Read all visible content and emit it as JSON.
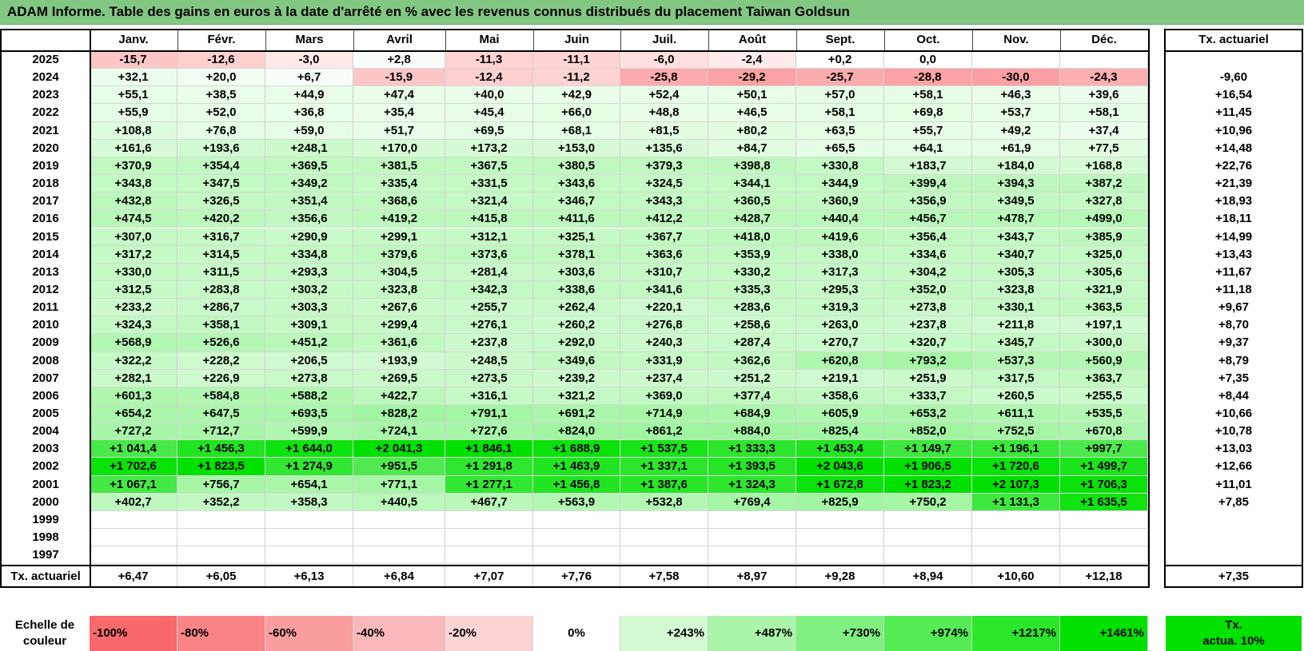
{
  "title": "ADAM Informe. Table des gains en euros à la date d'arrêté en % avec les revenus connus distribués du placement Taiwan Goldsun",
  "months": [
    "Janv.",
    "Févr.",
    "Mars",
    "Avril",
    "Mai",
    "Juin",
    "Juil.",
    "Août",
    "Sept.",
    "Oct.",
    "Nov.",
    "Déc."
  ],
  "rate_header": "Tx. actuariel",
  "rows": [
    {
      "year": "2025",
      "values": [
        "-15,7",
        "-12,6",
        "-3,0",
        "+2,8",
        "-11,3",
        "-11,1",
        "-6,0",
        "-2,4",
        "+0,2",
        "0,0",
        "",
        ""
      ],
      "rate": ""
    },
    {
      "year": "2024",
      "values": [
        "+32,1",
        "+20,0",
        "+6,7",
        "-15,9",
        "-12,4",
        "-11,2",
        "-25,8",
        "-29,2",
        "-25,7",
        "-28,8",
        "-30,0",
        "-24,3"
      ],
      "rate": "-9,60"
    },
    {
      "year": "2023",
      "values": [
        "+55,1",
        "+38,5",
        "+44,9",
        "+47,4",
        "+40,0",
        "+42,9",
        "+52,4",
        "+50,1",
        "+57,0",
        "+58,1",
        "+46,3",
        "+39,6"
      ],
      "rate": "+16,54"
    },
    {
      "year": "2022",
      "values": [
        "+55,9",
        "+52,0",
        "+36,8",
        "+35,4",
        "+45,4",
        "+66,0",
        "+48,8",
        "+46,5",
        "+58,1",
        "+69,8",
        "+53,7",
        "+58,1"
      ],
      "rate": "+11,45"
    },
    {
      "year": "2021",
      "values": [
        "+108,8",
        "+76,8",
        "+59,0",
        "+51,7",
        "+69,5",
        "+68,1",
        "+81,5",
        "+80,2",
        "+63,5",
        "+55,7",
        "+49,2",
        "+37,4"
      ],
      "rate": "+10,96"
    },
    {
      "year": "2020",
      "values": [
        "+161,6",
        "+193,6",
        "+248,1",
        "+170,0",
        "+173,2",
        "+153,0",
        "+135,6",
        "+84,7",
        "+65,5",
        "+64,1",
        "+61,9",
        "+77,5"
      ],
      "rate": "+14,48"
    },
    {
      "year": "2019",
      "values": [
        "+370,9",
        "+354,4",
        "+369,5",
        "+381,5",
        "+367,5",
        "+380,5",
        "+379,3",
        "+398,8",
        "+330,8",
        "+183,7",
        "+184,0",
        "+168,8"
      ],
      "rate": "+22,76"
    },
    {
      "year": "2018",
      "values": [
        "+343,8",
        "+347,5",
        "+349,2",
        "+335,4",
        "+331,5",
        "+343,6",
        "+324,5",
        "+344,1",
        "+344,9",
        "+399,4",
        "+394,3",
        "+387,2"
      ],
      "rate": "+21,39"
    },
    {
      "year": "2017",
      "values": [
        "+432,8",
        "+326,5",
        "+351,4",
        "+368,6",
        "+321,4",
        "+346,7",
        "+343,3",
        "+360,5",
        "+360,9",
        "+356,9",
        "+349,5",
        "+327,8"
      ],
      "rate": "+18,93"
    },
    {
      "year": "2016",
      "values": [
        "+474,5",
        "+420,2",
        "+356,6",
        "+419,2",
        "+415,8",
        "+411,6",
        "+412,2",
        "+428,7",
        "+440,4",
        "+456,7",
        "+478,7",
        "+499,0"
      ],
      "rate": "+18,11"
    },
    {
      "year": "2015",
      "values": [
        "+307,0",
        "+316,7",
        "+290,9",
        "+299,1",
        "+312,1",
        "+325,1",
        "+367,7",
        "+418,0",
        "+419,6",
        "+356,4",
        "+343,7",
        "+385,9"
      ],
      "rate": "+14,99"
    },
    {
      "year": "2014",
      "values": [
        "+317,2",
        "+314,5",
        "+334,8",
        "+379,6",
        "+373,6",
        "+378,1",
        "+363,6",
        "+353,9",
        "+338,0",
        "+334,6",
        "+340,7",
        "+325,0"
      ],
      "rate": "+13,43"
    },
    {
      "year": "2013",
      "values": [
        "+330,0",
        "+311,5",
        "+293,3",
        "+304,5",
        "+281,4",
        "+303,6",
        "+310,7",
        "+330,2",
        "+317,3",
        "+304,2",
        "+305,3",
        "+305,6"
      ],
      "rate": "+11,67"
    },
    {
      "year": "2012",
      "values": [
        "+312,5",
        "+283,8",
        "+303,2",
        "+323,8",
        "+342,3",
        "+338,6",
        "+341,6",
        "+335,3",
        "+295,3",
        "+352,0",
        "+323,8",
        "+321,9"
      ],
      "rate": "+11,18"
    },
    {
      "year": "2011",
      "values": [
        "+233,2",
        "+286,7",
        "+303,3",
        "+267,6",
        "+255,7",
        "+262,4",
        "+220,1",
        "+283,6",
        "+319,3",
        "+273,8",
        "+330,1",
        "+363,5"
      ],
      "rate": "+9,67"
    },
    {
      "year": "2010",
      "values": [
        "+324,3",
        "+358,1",
        "+309,1",
        "+299,4",
        "+276,1",
        "+260,2",
        "+276,8",
        "+258,6",
        "+263,0",
        "+237,8",
        "+211,8",
        "+197,1"
      ],
      "rate": "+8,70"
    },
    {
      "year": "2009",
      "values": [
        "+568,9",
        "+526,6",
        "+451,2",
        "+361,6",
        "+237,8",
        "+292,0",
        "+240,3",
        "+287,4",
        "+270,7",
        "+320,7",
        "+345,7",
        "+300,0"
      ],
      "rate": "+9,37"
    },
    {
      "year": "2008",
      "values": [
        "+322,2",
        "+228,2",
        "+206,5",
        "+193,9",
        "+248,5",
        "+349,6",
        "+331,9",
        "+362,6",
        "+620,8",
        "+793,2",
        "+537,3",
        "+560,9"
      ],
      "rate": "+8,79"
    },
    {
      "year": "2007",
      "values": [
        "+282,1",
        "+226,9",
        "+273,8",
        "+269,5",
        "+273,5",
        "+239,2",
        "+237,4",
        "+251,2",
        "+219,1",
        "+251,9",
        "+317,5",
        "+363,7"
      ],
      "rate": "+7,35"
    },
    {
      "year": "2006",
      "values": [
        "+601,3",
        "+584,8",
        "+588,2",
        "+422,7",
        "+316,1",
        "+321,2",
        "+369,0",
        "+377,4",
        "+358,6",
        "+333,7",
        "+260,5",
        "+255,5"
      ],
      "rate": "+8,44"
    },
    {
      "year": "2005",
      "values": [
        "+654,2",
        "+647,5",
        "+693,5",
        "+828,2",
        "+791,1",
        "+691,2",
        "+714,9",
        "+684,9",
        "+605,9",
        "+653,2",
        "+611,1",
        "+535,5"
      ],
      "rate": "+10,66"
    },
    {
      "year": "2004",
      "values": [
        "+727,2",
        "+712,7",
        "+599,9",
        "+724,1",
        "+727,6",
        "+824,0",
        "+861,2",
        "+884,0",
        "+825,4",
        "+852,0",
        "+752,5",
        "+670,8"
      ],
      "rate": "+10,78"
    },
    {
      "year": "2003",
      "values": [
        "+1 041,4",
        "+1 456,3",
        "+1 644,0",
        "+2 041,3",
        "+1 846,1",
        "+1 688,9",
        "+1 537,5",
        "+1 333,3",
        "+1 453,4",
        "+1 149,7",
        "+1 196,1",
        "+997,7"
      ],
      "rate": "+13,03"
    },
    {
      "year": "2002",
      "values": [
        "+1 702,6",
        "+1 823,5",
        "+1 274,9",
        "+951,5",
        "+1 291,8",
        "+1 463,9",
        "+1 337,1",
        "+1 393,5",
        "+2 043,6",
        "+1 906,5",
        "+1 720,6",
        "+1 499,7"
      ],
      "rate": "+12,66"
    },
    {
      "year": "2001",
      "values": [
        "+1 067,1",
        "+756,7",
        "+654,1",
        "+771,1",
        "+1 277,1",
        "+1 456,8",
        "+1 387,6",
        "+1 324,3",
        "+1 672,8",
        "+1 823,2",
        "+2 107,3",
        "+1 706,3"
      ],
      "rate": "+11,01"
    },
    {
      "year": "2000",
      "values": [
        "+402,7",
        "+352,2",
        "+358,3",
        "+440,5",
        "+467,7",
        "+563,9",
        "+532,8",
        "+769,4",
        "+825,9",
        "+750,2",
        "+1 131,3",
        "+1 635,5"
      ],
      "rate": "+7,85"
    },
    {
      "year": "1999",
      "values": [
        "",
        "",
        "",
        "",
        "",
        "",
        "",
        "",
        "",
        "",
        "",
        ""
      ],
      "rate": ""
    },
    {
      "year": "1998",
      "values": [
        "",
        "",
        "",
        "",
        "",
        "",
        "",
        "",
        "",
        "",
        "",
        ""
      ],
      "rate": ""
    },
    {
      "year": "1997",
      "values": [
        "",
        "",
        "",
        "",
        "",
        "",
        "",
        "",
        "",
        "",
        "",
        ""
      ],
      "rate": ""
    }
  ],
  "footer": {
    "label": "Tx. actuariel",
    "values": [
      "+6,47",
      "+6,05",
      "+6,13",
      "+6,84",
      "+7,07",
      "+7,76",
      "+7,58",
      "+8,97",
      "+9,28",
      "+8,94",
      "+10,60",
      "+12,18"
    ],
    "rate": "+7,35"
  },
  "scale": {
    "label_line1": "Echelle de",
    "label_line2": "couleur",
    "items": [
      {
        "text": "-100%",
        "color": "#f8696b",
        "align": "left"
      },
      {
        "text": "-80%",
        "color": "#f98486",
        "align": "left"
      },
      {
        "text": "-60%",
        "color": "#fa9ea0",
        "align": "left"
      },
      {
        "text": "-40%",
        "color": "#fbb8ba",
        "align": "left"
      },
      {
        "text": "-20%",
        "color": "#fdd3d4",
        "align": "left"
      },
      {
        "text": "0%",
        "color": "#ffffff",
        "align": "center"
      },
      {
        "text": "+243%",
        "color": "#d4fad4",
        "align": "right"
      },
      {
        "text": "+487%",
        "color": "#aaf5aa",
        "align": "right"
      },
      {
        "text": "+730%",
        "color": "#80f080",
        "align": "right"
      },
      {
        "text": "+974%",
        "color": "#55eb55",
        "align": "right"
      },
      {
        "text": "+1217%",
        "color": "#2be62b",
        "align": "right"
      },
      {
        "text": "+1461%",
        "color": "#00e100",
        "align": "right"
      }
    ],
    "rate_line1": "Tx.",
    "rate_line2": "actua. 10%",
    "rate_color": "#00e100"
  }
}
